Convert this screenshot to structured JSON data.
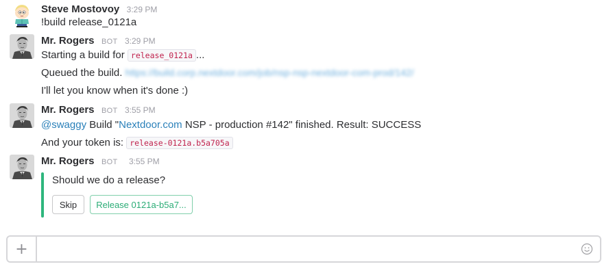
{
  "messages": [
    {
      "sender": "Steve Mostovoy",
      "time": "3:29 PM",
      "text": "!build release_0121a"
    },
    {
      "sender": "Mr. Rogers",
      "bot_tag": "BOT",
      "time": "3:29 PM",
      "line1_prefix": "Starting a build for ",
      "line1_code": "release_0121a",
      "line1_suffix": "...",
      "line2_prefix": "Queued the build. ",
      "line2_link": "https://build.corp.nextdoor.com/job/nsp-nsp-nextdoor-com-prod/142/",
      "line3": "I'll let you know when it's done :)"
    },
    {
      "sender": "Mr. Rogers",
      "bot_tag": "BOT",
      "time": "3:55 PM",
      "mention": "@swaggy",
      "line1_part1": " Build \"",
      "line1_link": "Nextdoor.com",
      "line1_part2": " NSP - production #142\" finished. Result: SUCCESS",
      "line2_prefix": "And your token is: ",
      "line2_code": "release-0121a.b5a705a"
    },
    {
      "sender": "Mr. Rogers",
      "bot_tag": "BOT",
      "time": "3:55 PM",
      "attachment_text": "Should we do a release?",
      "buttons": [
        "Skip",
        "Release 0121a-b5a7..."
      ]
    }
  ],
  "composer": {
    "plus": "+",
    "placeholder": ""
  },
  "colors": {
    "accent_green": "#2eb67d",
    "link_blue": "#2a80b9",
    "code_red": "#c0224d"
  },
  "icons": {
    "avatar_steve": "butters-avatar-icon",
    "avatar_bot": "mr-rogers-avatar-icon",
    "emoji": "smiley-face-icon"
  }
}
